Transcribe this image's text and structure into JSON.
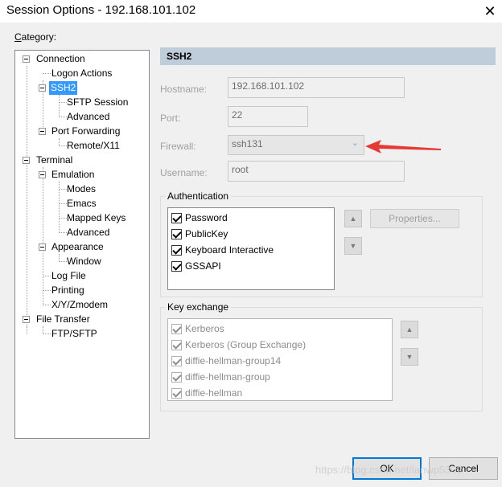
{
  "window": {
    "title": "Session Options - 192.168.101.102",
    "close_glyph": "✕"
  },
  "category": {
    "label_accel": "C",
    "label_rest": "ategory:"
  },
  "tree": {
    "items": [
      {
        "label": "Connection"
      },
      {
        "label": "Logon Actions"
      },
      {
        "label": "SSH2"
      },
      {
        "label": "SFTP Session"
      },
      {
        "label": "Advanced"
      },
      {
        "label": "Port Forwarding"
      },
      {
        "label": "Remote/X11"
      },
      {
        "label": "Terminal"
      },
      {
        "label": "Emulation"
      },
      {
        "label": "Modes"
      },
      {
        "label": "Emacs"
      },
      {
        "label": "Mapped Keys"
      },
      {
        "label": "Advanced"
      },
      {
        "label": "Appearance"
      },
      {
        "label": "Window"
      },
      {
        "label": "Log File"
      },
      {
        "label": "Printing"
      },
      {
        "label": "X/Y/Zmodem"
      },
      {
        "label": "File Transfer"
      },
      {
        "label": "FTP/SFTP"
      }
    ]
  },
  "panel": {
    "header": "SSH2",
    "hostname_label": "Hostname:",
    "hostname_value": "192.168.101.102",
    "port_label": "Port:",
    "port_value": "22",
    "firewall_label": "Firewall:",
    "firewall_value": "ssh131",
    "username_label": "Username:",
    "username_value": "root"
  },
  "authentication": {
    "title": "Authentication",
    "items": [
      "Password",
      "PublicKey",
      "Keyboard Interactive",
      "GSSAPI"
    ],
    "properties_label": "Properties..."
  },
  "key_exchange": {
    "title": "Key exchange",
    "items": [
      "Kerberos",
      "Kerberos (Group Exchange)",
      "diffie-hellman-group14",
      "diffie-hellman-group",
      "diffie-hellman"
    ]
  },
  "footer": {
    "ok_label": "OK",
    "cancel_label": "Cancel",
    "watermark": "https://blog.csdn.net/lanwp5302"
  },
  "annotation": {
    "arrow_color": "#e53935"
  },
  "colors": {
    "selected": "#3399ff",
    "header_bg": "#bfcddb",
    "primary_border": "#0078d7"
  }
}
